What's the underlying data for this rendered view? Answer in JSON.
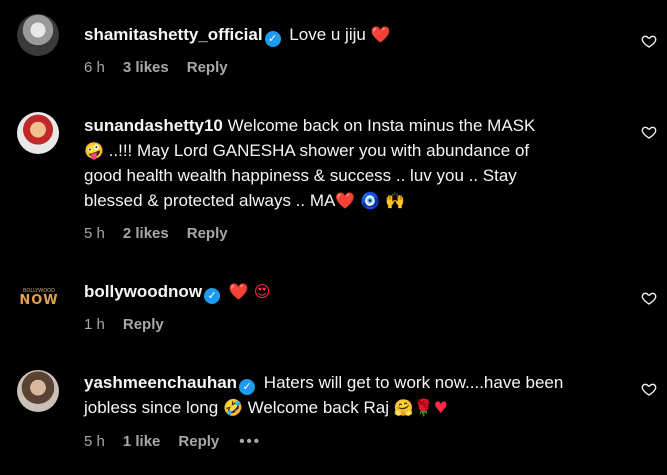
{
  "comments": [
    {
      "username": "shamitashetty_official",
      "verified": true,
      "text": "Love u jiju",
      "emoji_after": "❤️",
      "time": "6 h",
      "likes": "3 likes",
      "reply": "Reply"
    },
    {
      "username": "sunandashetty10",
      "verified": false,
      "text_line1": "Welcome back on Insta minus the MASK",
      "text_line2": "..!!! May Lord GANESHA shower you with abundance of",
      "text_line3": "good health wealth happiness & success .. luv you .. Stay",
      "text_line4": "blessed & protected always .. MA",
      "emoji_line2": "🤪",
      "emoji_line4": "❤️ 🧿 🙌",
      "time": "5 h",
      "likes": "2 likes",
      "reply": "Reply"
    },
    {
      "username": "bollywoodnow",
      "verified": true,
      "emoji_text": "❤️ 😍",
      "avatar_text_top": "BOLLYWOOD",
      "avatar_text_main": "NOW",
      "time": "1 h",
      "reply": "Reply"
    },
    {
      "username": "yashmeenchauhan",
      "verified": true,
      "text_line1": "Haters will get to work now....have been",
      "text_line2a": "jobless since long",
      "emoji_mid": "🤣",
      "text_line2b": "Welcome back Raj",
      "emoji_end": "🤗🌹♥",
      "time": "5 h",
      "likes": "1 like",
      "reply": "Reply",
      "more": "•••"
    }
  ],
  "colors": {
    "background": "#000000",
    "text": "#f5f5f5",
    "meta": "#a8a8a8",
    "verified": "#1d9bf0",
    "heart": "#ff2a4a"
  },
  "icons": [
    "verified-badge-icon",
    "heart-outline-icon"
  ]
}
